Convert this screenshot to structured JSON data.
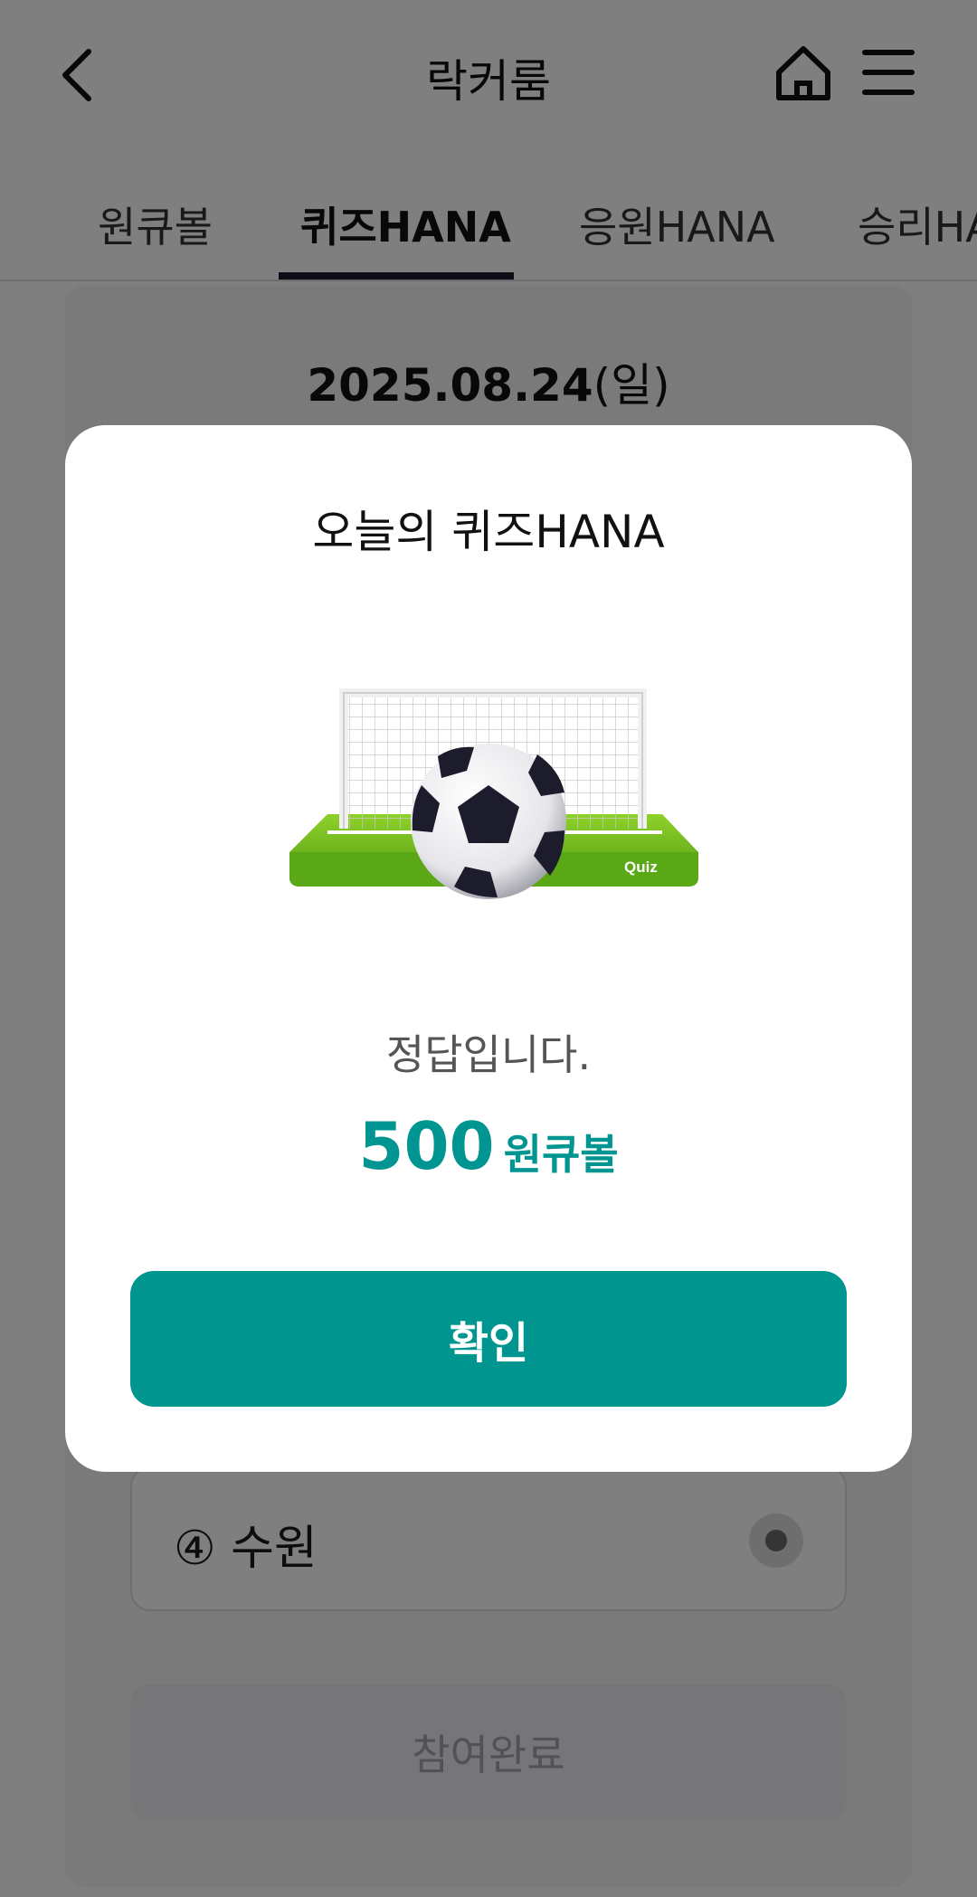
{
  "header": {
    "title": "락커룸",
    "back_icon": "chevron-left-icon",
    "home_icon": "home-icon",
    "menu_icon": "hamburger-menu-icon"
  },
  "tabs": [
    {
      "label": "원큐볼",
      "active": false
    },
    {
      "label": "퀴즈HANA",
      "active": true
    },
    {
      "label": "응원HANA",
      "active": false
    },
    {
      "label": "승리HANA",
      "active": false
    }
  ],
  "quiz": {
    "date": "2025.08.24",
    "day": "(일)",
    "option_4": "④ 수원",
    "submit_label": "참여완료"
  },
  "modal": {
    "title": "오늘의 퀴즈HANA",
    "illustration_icon": "soccer-goal-quiz-icon",
    "illustration_text": "Quiz",
    "result_text": "정답입니다.",
    "reward_amount": "500",
    "reward_unit": "원큐볼",
    "confirm_label": "확인"
  },
  "colors": {
    "accent": "#00968F",
    "tab_underline": "#1B1B2E",
    "overlay": "rgba(0,0,0,0.5)"
  }
}
